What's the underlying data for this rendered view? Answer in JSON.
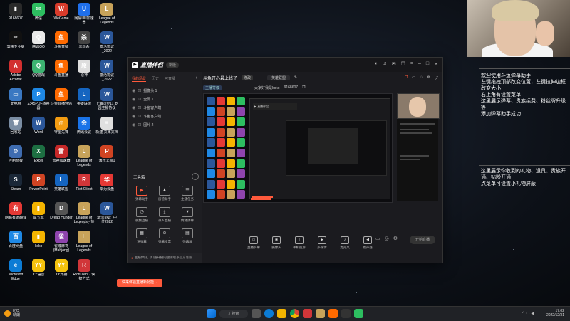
{
  "desktop_icons": [
    {
      "label": "9168607",
      "color": "#2a2a2a",
      "glyph": "▮"
    },
    {
      "label": "微信",
      "color": "#2dbe60",
      "glyph": "✉"
    },
    {
      "label": "WeGame",
      "color": "#d83b2b",
      "glyph": "W"
    },
    {
      "label": "网易UU加速器",
      "color": "#1f6feb",
      "glyph": "U"
    },
    {
      "label": "League of Legends",
      "color": "#c8a35a",
      "glyph": "L"
    },
    {
      "label": "剪映专业版",
      "color": "#111",
      "glyph": "✂"
    },
    {
      "label": "腾讯QQ",
      "color": "#e9e9e9",
      "glyph": "Q"
    },
    {
      "label": "斗鱼直播",
      "color": "#ff6a00",
      "glyph": "鱼"
    },
    {
      "label": "三国杀",
      "color": "#444",
      "glyph": "杀"
    },
    {
      "label": "激活协议_2022",
      "color": "#2b579a",
      "glyph": "W"
    },
    {
      "label": "Adobe Acrobat",
      "color": "#d32f2f",
      "glyph": "A"
    },
    {
      "label": "QQ游戏",
      "color": "#3cb371",
      "glyph": "Q"
    },
    {
      "label": "斗鱼直播",
      "color": "#ff6a00",
      "glyph": "鱼"
    },
    {
      "label": "原神",
      "color": "#ddd",
      "glyph": "原"
    },
    {
      "label": "激活协议_2022",
      "color": "#2b579a",
      "glyph": "W"
    },
    {
      "label": "此电脑",
      "color": "#3a78c2",
      "glyph": "▭"
    },
    {
      "label": "2345PDF转换器",
      "color": "#1e88e5",
      "glyph": "P"
    },
    {
      "label": "斗鱼直播伴侣",
      "color": "#ff6a00",
      "glyph": "鱼"
    },
    {
      "label": "英雄联盟",
      "color": "#1565c0",
      "glyph": "L"
    },
    {
      "label": "上海同步11 乾园主播协议",
      "color": "#2b579a",
      "glyph": "W"
    },
    {
      "label": "回收站",
      "color": "#7a8da3",
      "glyph": "🗑"
    },
    {
      "label": "Word",
      "color": "#2b579a",
      "glyph": "W"
    },
    {
      "label": "守望先锋",
      "color": "#f39c12",
      "glyph": "◎"
    },
    {
      "label": "腾讯会议",
      "color": "#1a73e8",
      "glyph": "会"
    },
    {
      "label": "新建 文本文档",
      "color": "#e0e0e0",
      "glyph": "≡"
    },
    {
      "label": "控制面板",
      "color": "#3f6cb0",
      "glyph": "⚙"
    },
    {
      "label": "Excel",
      "color": "#1d6f42",
      "glyph": "X"
    },
    {
      "label": "雷神加速器",
      "color": "#c62828",
      "glyph": "雷"
    },
    {
      "label": "League of Legends",
      "color": "#c8a35a",
      "glyph": "L"
    },
    {
      "label": "演示文稿1",
      "color": "#d04423",
      "glyph": "P"
    },
    {
      "label": "Steam",
      "color": "#1b2838",
      "glyph": "S"
    },
    {
      "label": "PowerPoint",
      "color": "#d04423",
      "glyph": "P"
    },
    {
      "label": "英雄联盟",
      "color": "#1565c0",
      "glyph": "L"
    },
    {
      "label": "Riot Client",
      "color": "#d13639",
      "glyph": "R"
    },
    {
      "label": "华为云盘",
      "color": "#e53935",
      "glyph": "华"
    },
    {
      "label": "网易有道翻译",
      "color": "#e53935",
      "glyph": "有"
    },
    {
      "label": "填五城",
      "color": "#f4b400",
      "glyph": "▮"
    },
    {
      "label": "Dread Hunger",
      "color": "#555",
      "glyph": "D"
    },
    {
      "label": "League of Legends - 快捷方式",
      "color": "#c8a35a",
      "glyph": "L"
    },
    {
      "label": "激活协议_中位2022",
      "color": "#2b579a",
      "glyph": "W"
    },
    {
      "label": "百度网盘",
      "color": "#1e88e5",
      "glyph": "百"
    },
    {
      "label": "koko",
      "color": "#f4b400",
      "glyph": "▮"
    },
    {
      "label": "雀魂麻将 (Mahjong)",
      "color": "#8e44ad",
      "glyph": "雀"
    },
    {
      "label": "League of Legends",
      "color": "#c8a35a",
      "glyph": "L"
    },
    {
      "label": "",
      "color": "transparent",
      "glyph": ""
    },
    {
      "label": "Microsoft Edge",
      "color": "#0c7cd5",
      "glyph": "e"
    },
    {
      "label": "YY语音",
      "color": "#f4c20d",
      "glyph": "YY"
    },
    {
      "label": "YY开播",
      "color": "#f4c20d",
      "glyph": "YY"
    },
    {
      "label": "RiotClient - 快捷方式",
      "color": "#d13639",
      "glyph": "R"
    }
  ],
  "app": {
    "name": "直播伴侣",
    "version": "新版",
    "left_tabs": [
      "我的场景",
      "历史",
      "可直播"
    ],
    "scenes": [
      "摄像头 1",
      "全屏 1",
      "斗鱼客户端",
      "斗鱼客户端",
      "图片 2"
    ],
    "tools_title": "工具箱",
    "tools_more": "…",
    "tools": [
      {
        "label": "弹幕助手",
        "icon": "▶",
        "hot": true
      },
      {
        "label": "房管助手",
        "icon": "♟",
        "hot": false
      },
      {
        "label": "主播任务",
        "icon": "☰",
        "hot": false
      },
      {
        "label": "视频直播",
        "icon": "◷",
        "hot": false
      },
      {
        "label": "录人直播",
        "icon": "⤓",
        "hot": false
      },
      {
        "label": "情绪弹幕",
        "icon": "♥",
        "hot": false
      },
      {
        "label": "送弹幕",
        "icon": "▦",
        "hot": false
      },
      {
        "label": "弹幕投票",
        "icon": "⊕",
        "hot": false
      },
      {
        "label": "弹幕屏",
        "icon": "▤",
        "hot": false
      }
    ],
    "notice": "主播你好，如遇开播问题请联系官方客服",
    "room_title": "斗鱼开心最上线了",
    "room_tag": "修改",
    "category": "英雄联盟",
    "host_label": "大家好我是koko",
    "room_id": "9168607",
    "bottom_buttons": [
      {
        "label": "直播屏幕",
        "icon": "▭"
      },
      {
        "label": "摄像头",
        "icon": "◉"
      },
      {
        "label": "手机投屏",
        "icon": "▯"
      },
      {
        "label": "多媒体",
        "icon": "▶"
      },
      {
        "label": "麦克风",
        "icon": "♪"
      },
      {
        "label": "扬声器",
        "icon": "◀"
      }
    ],
    "start_button": "开始直播"
  },
  "orange_tip": "快来体验直播新功能→",
  "info_lines": [
    "欢迎使用斗鱼弹幕助手",
    "左键拖拽顶部改变位置，左键拉伸边框改变大小",
    "右上角有设置菜单",
    "这里展示弹幕、贵族续费、粉丝牌升级等",
    "添加弹幕助手成功"
  ],
  "info2_lines": [
    "这里展示你收到的礼物、道具、贵族开通、钻粉开通",
    "点菜单可设置小礼物屏蔽"
  ],
  "taskbar": {
    "weather_temp": "8°C",
    "weather_desc": "晴朗",
    "search_label": "搜索",
    "time": "17:02",
    "date": "2022/12/31"
  },
  "colors": {
    "accent": "#ff5a3c",
    "taskbar": "#202226"
  }
}
